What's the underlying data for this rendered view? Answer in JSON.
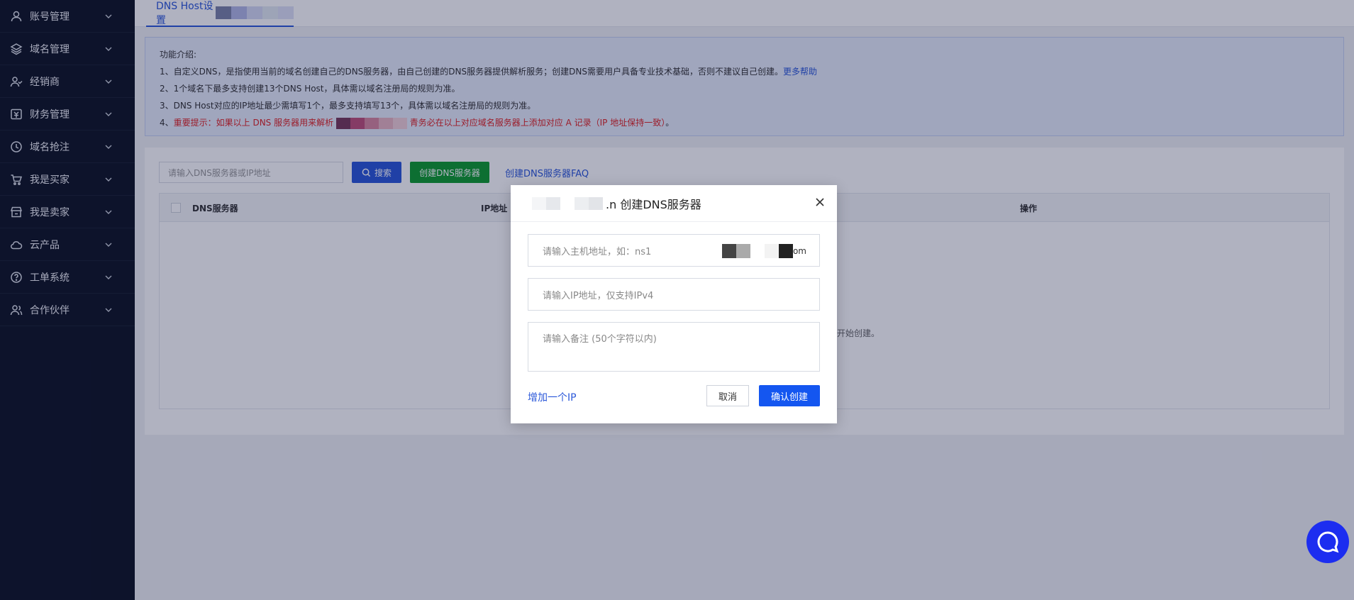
{
  "sidebar": {
    "items": [
      {
        "label": "账号管理",
        "icon": "user-icon"
      },
      {
        "label": "域名管理",
        "icon": "layers-icon"
      },
      {
        "label": "经销商",
        "icon": "user-group-icon"
      },
      {
        "label": "财务管理",
        "icon": "finance-icon"
      },
      {
        "label": "域名抢注",
        "icon": "clock-icon"
      },
      {
        "label": "我是买家",
        "icon": "cart-icon"
      },
      {
        "label": "我是卖家",
        "icon": "store-icon"
      },
      {
        "label": "云产品",
        "icon": "cloud-icon"
      },
      {
        "label": "工单系统",
        "icon": "help-icon"
      },
      {
        "label": "合作伙伴",
        "icon": "partner-icon"
      }
    ]
  },
  "tabs": {
    "active": "DNS Host设置"
  },
  "intro": {
    "heading": "功能介绍:",
    "line1": "1、自定义DNS，是指使用当前的域名创建自己的DNS服务器，由自己创建的DNS服务器提供解析服务；创建DNS需要用户具备专业技术基础，否则不建议自己创建。",
    "line1_link": "更多帮助",
    "line2": "2、1个域名下最多支持创建13个DNS Host，具体需以域名注册局的规则为准。",
    "line3": "3、DNS Host对应的IP地址最少需填写1个，最多支持填写13个，具体需以域名注册局的规则为准。",
    "line4_prefix": "4、",
    "line4_red_a": "重要提示：如果以上 DNS 服务器用来解析",
    "line4_red_b": "青务必在以上对应域名服务器上添加对应 A 记录（IP 地址保持一致）",
    "line4_suffix": "。"
  },
  "toolbar": {
    "search_placeholder": "请输入DNS服务器或IP地址",
    "search_label": "搜索",
    "create_label": "创建DNS服务器",
    "faq_label": "创建DNS服务器FAQ"
  },
  "table": {
    "columns": [
      "DNS服务器",
      "IP地址",
      "操作"
    ],
    "empty_text": "开始创建。"
  },
  "modal": {
    "title_suffix": ".n 创建DNS服务器",
    "host_placeholder": "请输入主机地址，如：ns1",
    "host_domain_suffix": "om",
    "ip_placeholder": "请输入IP地址，仅支持IPv4",
    "note_placeholder": "请输入备注 (50个字符以内)",
    "add_ip_label": "增加一个IP",
    "cancel_label": "取消",
    "confirm_label": "确认创建"
  },
  "colors": {
    "accent": "#2b58d9",
    "create_green": "#0f9d2f",
    "confirm_blue": "#1456f0",
    "warning_red": "#e02424",
    "sidebar_bg": "#0f1524"
  }
}
